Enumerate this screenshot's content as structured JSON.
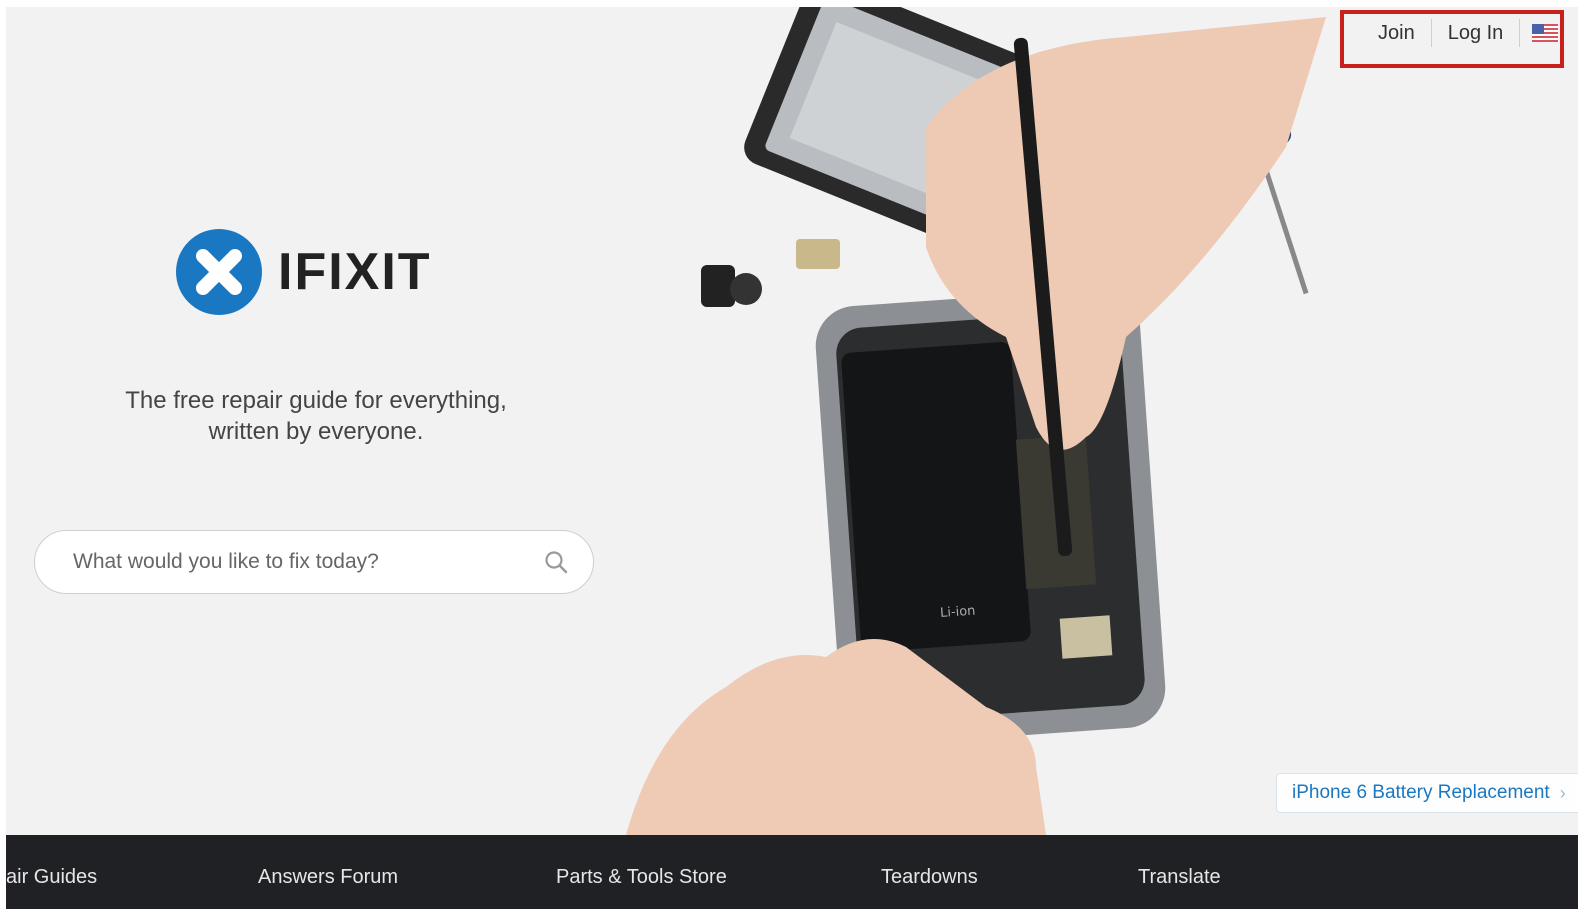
{
  "brand": {
    "name": "IFIXIT",
    "tagline_line1": "The free repair guide for everything,",
    "tagline_line2": "written by everyone.",
    "accent_color": "#1a78c2"
  },
  "search": {
    "placeholder": "What would you like to fix today?",
    "icon": "search-icon"
  },
  "account": {
    "join_label": "Join",
    "login_label": "Log In",
    "language_icon": "us-flag-icon",
    "highlight_color": "#c8201b"
  },
  "featured_guide": {
    "label": "iPhone 6 Battery Replacement",
    "chevron": "›"
  },
  "bottom_nav": {
    "items": [
      {
        "label": "air Guides"
      },
      {
        "label": "Answers Forum"
      },
      {
        "label": "Parts & Tools Store"
      },
      {
        "label": "Teardowns"
      },
      {
        "label": "Translate"
      }
    ]
  }
}
